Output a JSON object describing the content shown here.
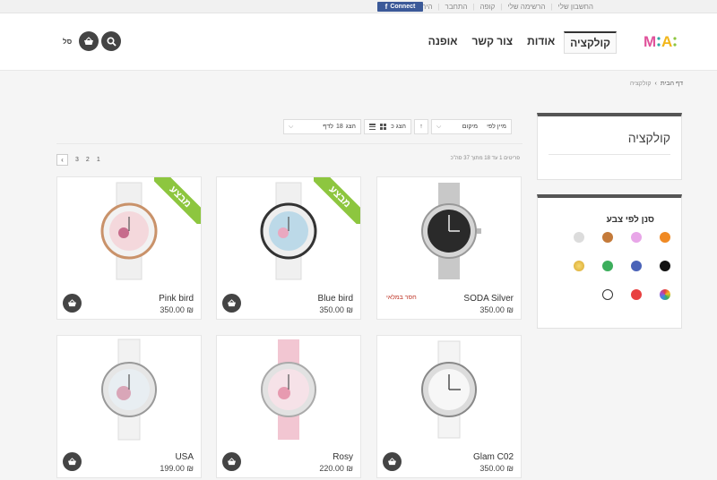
{
  "topbar": {
    "links": [
      "החשבון שלי",
      "הרשימה שלי",
      "קופה",
      "התחבר",
      "הירשם"
    ],
    "fb_connect": "Connect",
    "fb_f": "f"
  },
  "header": {
    "logo_text": "M:A:",
    "nav": [
      "קולקציה",
      "אודות",
      "צור קשר",
      "אופנה"
    ],
    "cart_label": "סל"
  },
  "breadcrumb": {
    "home": "דף הבית",
    "sep": "›",
    "current": "קולקציה"
  },
  "sidebar": {
    "collection_title": "קולקציה",
    "filter_title": "סנן לפי צבע",
    "colors": [
      "#f08a24",
      "#e8a6e8",
      "#c47a3a",
      "#dcdcdc",
      "#111111",
      "#4a63b8",
      "#3cae5c",
      "#e0b040",
      "#e0c060",
      "#e84040",
      "#ffffff"
    ]
  },
  "toolbar": {
    "sort_label": "מיין לפי",
    "sort_value": "מיקום",
    "show_label": "הצג",
    "show_value": "18",
    "per_page": "לדף",
    "view_label": "הצג כ"
  },
  "pager": {
    "pages": [
      "1",
      "2",
      "3"
    ],
    "prev": "‹",
    "results": "פריטים 1 עד 18 מתוך 37 סה\"כ"
  },
  "products": [
    {
      "name": "SODA Silver",
      "price": "350.00 ₪",
      "oos": "חסר במלאי",
      "sale": ""
    },
    {
      "name": "Blue bird",
      "price": "350.00 ₪",
      "oos": "",
      "sale": "מבצע"
    },
    {
      "name": "Pink bird",
      "price": "350.00 ₪",
      "oos": "",
      "sale": "מבצע"
    },
    {
      "name": "Glam C02",
      "price": "350.00 ₪",
      "oos": "",
      "sale": ""
    },
    {
      "name": "Rosy",
      "price": "220.00 ₪",
      "oos": "",
      "sale": ""
    },
    {
      "name": "USA",
      "price": "199.00 ₪",
      "oos": "",
      "sale": ""
    }
  ]
}
